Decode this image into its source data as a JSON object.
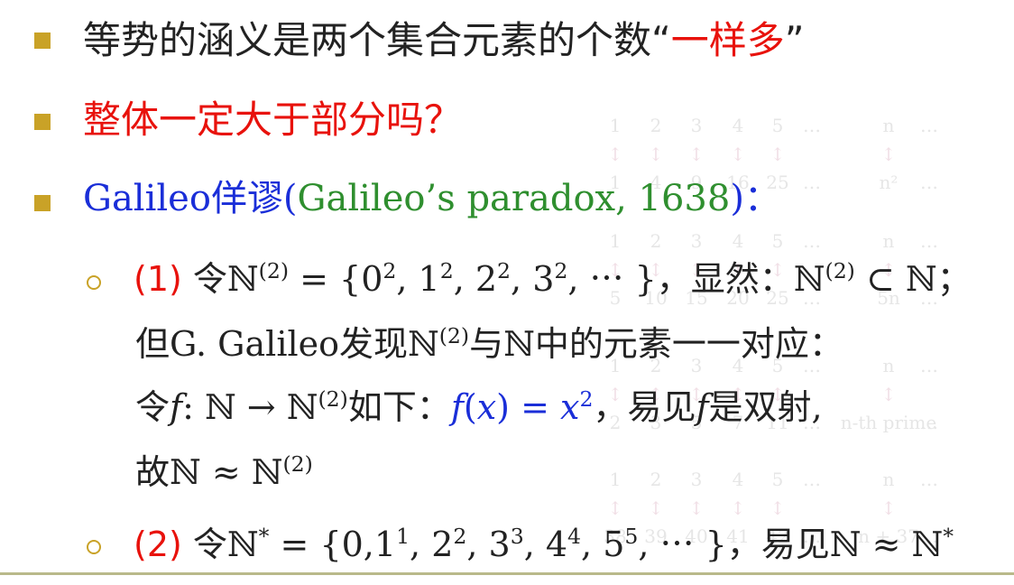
{
  "bullets": [
    {
      "text_a": "等势的涵义是两个集合元素的个数",
      "quote_open": "“",
      "quote_red": "一样多",
      "quote_close": "”"
    },
    {
      "text": "整体一定大于部分吗？"
    },
    {
      "name_blue": "Galileo佯谬(",
      "name_green": "Galileo’s paradox, 1638",
      "close_blue": ")",
      "colon": "："
    }
  ],
  "sub1": {
    "label": "(1)",
    "l1_a": "令ℕ",
    "l1_sup": "(2)",
    "l1_b": " = {0",
    "l1_s1": "2",
    "l1_c": ", 1",
    "l1_s2": "2",
    "l1_d": ", 2",
    "l1_s3": "2",
    "l1_e": ", 3",
    "l1_s4": "2",
    "l1_f": ", ⋯ }，显然：ℕ",
    "l1_sup2": "(2)",
    "l1_g": " ⊂ ℕ；",
    "l2_a": "但G. Galileo发现ℕ",
    "l2_sup": "(2)",
    "l2_b": "与ℕ中的元素一一对应：",
    "l3_a": "令",
    "l3_f": "f",
    "l3_b": ": ℕ → ℕ",
    "l3_sup": "(2)",
    "l3_c": "如下：",
    "l3_blue_a": "f",
    "l3_blue_b": "(",
    "l3_blue_x": "x",
    "l3_blue_c": ") = ",
    "l3_blue_x2": "x",
    "l3_blue_sup": "2",
    "l3_d": "，易见",
    "l3_f2": "f",
    "l3_e": "是双射,",
    "l4_a": "故ℕ ≈ ℕ",
    "l4_sup": "(2)"
  },
  "sub2": {
    "label": "(2)",
    "t_a": "令ℕ",
    "t_star": "*",
    "t_b": " = {0,1",
    "s1": "1",
    "t_c": ", 2",
    "s2": "2",
    "t_d": ", 3",
    "s3": "3",
    "t_e": ", 4",
    "s4": "4",
    "t_f": ", 5",
    "s5": "5",
    "t_g": ", ⋯ }，易见ℕ ≈ ℕ",
    "t_star2": "*"
  },
  "watermark": {
    "rows": [
      [
        "1",
        "2",
        "3",
        "4",
        "5",
        "…",
        "n",
        "…"
      ],
      [
        "1",
        "4",
        "9",
        "16",
        "25",
        "…",
        "n²",
        "…"
      ],
      [
        "1",
        "2",
        "3",
        "4",
        "5",
        "…",
        "n",
        "…"
      ],
      [
        "5",
        "10",
        "15",
        "20",
        "25",
        "…",
        "5n",
        "…"
      ],
      [
        "1",
        "2",
        "3",
        "4",
        "5",
        "…",
        "n",
        "…"
      ],
      [
        "2",
        "3",
        "5",
        "7",
        "11",
        "…",
        "n-th prime",
        "…"
      ],
      [
        "1",
        "2",
        "3",
        "4",
        "5",
        "…",
        "n",
        "…"
      ],
      [
        "38",
        "39",
        "40",
        "41",
        "42",
        "…",
        "n + 37",
        "…"
      ]
    ],
    "arrow": "↕"
  }
}
